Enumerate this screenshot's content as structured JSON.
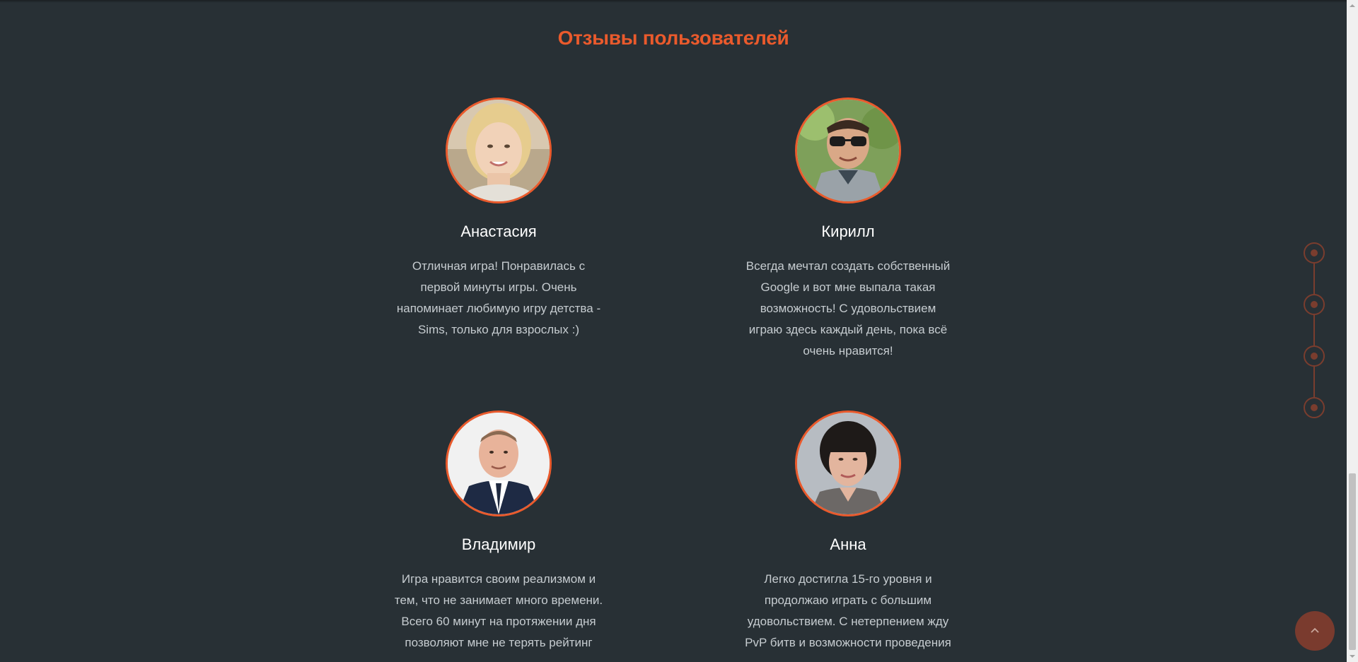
{
  "section": {
    "title": "Отзывы пользователей"
  },
  "reviews": [
    {
      "name": "Анастасия",
      "text": "Отличная игра! Понравилась с первой минуты игры. Очень напоминает любимую игру детства - Sims, только для взрослых :)"
    },
    {
      "name": "Кирилл",
      "text": "Всегда мечтал создать собственный Google и вот мне выпала такая возможность! С удовольствием играю здесь каждый день, пока всё очень нравится!"
    },
    {
      "name": "Владимир",
      "text": "Игра нравится своим реализмом и тем, что не занимает много времени. Всего 60 минут на протяжении дня позволяют мне не терять рейтинг"
    },
    {
      "name": "Анна",
      "text": "Легко достигла 15-го уровня и продолжаю играть с большим удовольствием. С нетерпением жду PvP битв и возможности проведения"
    }
  ],
  "colors": {
    "accent": "#ea5a2c",
    "background": "#283035",
    "nav": "#7a3d2e"
  },
  "icons": {
    "scroll_top": "chevron-up-icon"
  }
}
